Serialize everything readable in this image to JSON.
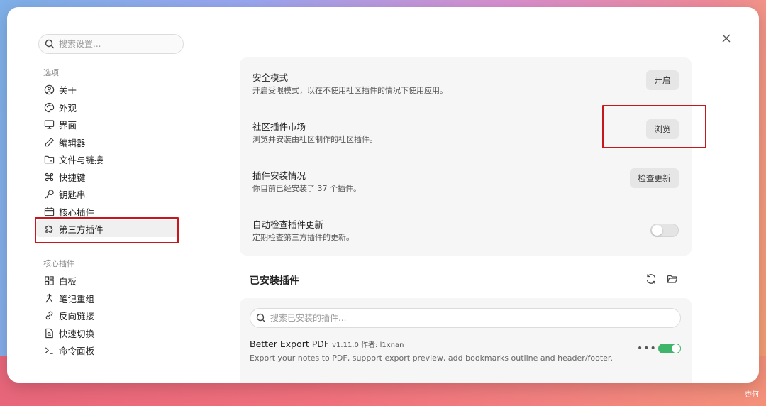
{
  "search": {
    "placeholder": "搜索设置..."
  },
  "sidebar": {
    "section_options": "选项",
    "options_items": [
      {
        "label": "关于",
        "icon": "info-circle-icon"
      },
      {
        "label": "外观",
        "icon": "palette-icon"
      },
      {
        "label": "界面",
        "icon": "monitor-icon"
      },
      {
        "label": "编辑器",
        "icon": "pencil-icon"
      },
      {
        "label": "文件与链接",
        "icon": "folder-link-icon"
      },
      {
        "label": "快捷键",
        "icon": "command-icon"
      },
      {
        "label": "钥匙串",
        "icon": "key-icon"
      },
      {
        "label": "核心插件",
        "icon": "calendar-icon"
      },
      {
        "label": "第三方插件",
        "icon": "puzzle-icon"
      }
    ],
    "section_core": "核心插件",
    "core_items": [
      {
        "label": "白板",
        "icon": "layout-grid-icon"
      },
      {
        "label": "笔记重组",
        "icon": "merge-arrow-icon"
      },
      {
        "label": "反向链接",
        "icon": "backlink-icon"
      },
      {
        "label": "快速切换",
        "icon": "file-search-icon"
      },
      {
        "label": "命令面板",
        "icon": "terminal-icon"
      }
    ]
  },
  "settings": {
    "safe_mode": {
      "title": "安全模式",
      "desc": "开启受限模式，以在不使用社区插件的情况下使用应用。",
      "button": "开启"
    },
    "community": {
      "title": "社区插件市场",
      "desc": "浏览并安装由社区制作的社区插件。",
      "button": "浏览"
    },
    "status": {
      "title": "插件安装情况",
      "desc": "你目前已经安装了 37 个插件。",
      "button": "检查更新"
    },
    "auto_check": {
      "title": "自动检查插件更新",
      "desc": "定期检查第三方插件的更新。",
      "enabled": false
    }
  },
  "installed": {
    "title": "已安装插件",
    "search_placeholder": "搜索已安装的插件...",
    "plugins": [
      {
        "name": "Better Export PDF",
        "meta": "v1.11.0 作者: l1xnan",
        "desc": "Export your notes to PDF, support export preview, add bookmarks outline and header/footer.",
        "enabled": true
      }
    ]
  },
  "watermark": "杏何",
  "colors": {
    "highlight": "#c8161d",
    "toggle_on": "#3fb46b"
  }
}
